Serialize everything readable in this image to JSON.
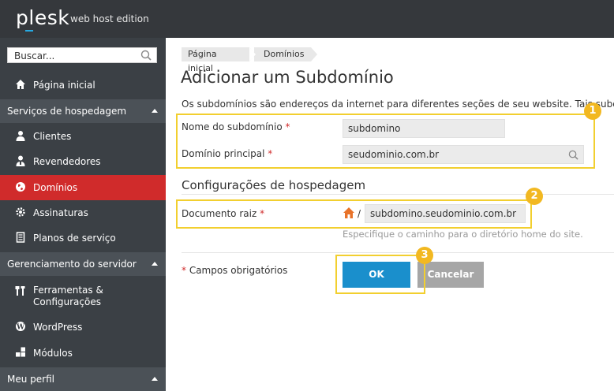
{
  "header": {
    "logo": "plesk",
    "edition": "web host edition"
  },
  "sidebar": {
    "search_placeholder": "Buscar...",
    "home": "Página inicial",
    "sections": [
      {
        "label": "Serviços de hospedagem",
        "items": [
          "Clientes",
          "Revendedores",
          "Domínios",
          "Assinaturas",
          "Planos de serviço"
        ]
      },
      {
        "label": "Gerenciamento do servidor",
        "items": [
          "Ferramentas & Configurações",
          "WordPress",
          "Módulos"
        ]
      },
      {
        "label": "Meu perfil"
      }
    ],
    "tools_line1": "Ferramentas &",
    "tools_line2": "Configurações",
    "active_item": "Domínios"
  },
  "breadcrumb": [
    "Página inicial",
    "Domínios"
  ],
  "page": {
    "title": "Adicionar um Subdomínio",
    "description": "Os subdomínios são endereços da internet para diferentes seções de seu website. Tais subdom",
    "fields": {
      "subdomain_label": "Nome do subdomínio",
      "subdomain_value": "subdomino",
      "parent_label": "Domínio principal",
      "parent_value": "seudominio.com.br"
    },
    "hosting_title": "Configurações de hospedagem",
    "docroot_label": "Documento raiz",
    "docroot_sep": "/",
    "docroot_value": "subdomino.seudominio.com.br",
    "docroot_hint": "Especifique o caminho para o diretório home do site.",
    "required_star": "*",
    "required_note": "Campos obrigatórios",
    "ok": "OK",
    "cancel": "Cancelar"
  },
  "badges": [
    "1",
    "2",
    "3"
  ],
  "colors": {
    "accent": "#1a8fcc",
    "active": "#d02b2b",
    "highlight": "#f2cf2f",
    "badge": "#f2b821"
  }
}
